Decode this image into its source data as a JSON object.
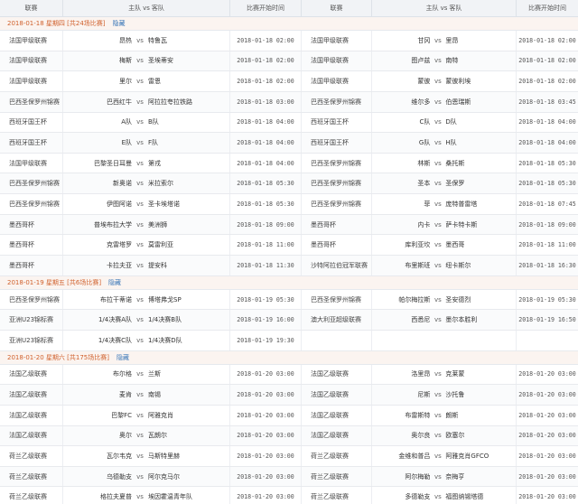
{
  "header": {
    "league": "联赛",
    "home": "主队",
    "vs": "vs",
    "away": "客队",
    "time": "比赛开始时间",
    "league2": "联赛",
    "time2": "比赛开始时间"
  },
  "days": [
    {
      "label": "2018-01-18 星期四 [共24场比赛]",
      "fold": "隐藏",
      "rows": [
        {
          "l1": "法国甲级联赛",
          "h1": "昂热",
          "a1": "特鲁瓦",
          "t1": "2018-01-18 02:00",
          "l2": "法国甲级联赛",
          "h2": "甘冈",
          "a2": "里昂",
          "t2": "2018-01-18 02:00"
        },
        {
          "l1": "法国甲级联赛",
          "h1": "梅斯",
          "a1": "圣埃蒂安",
          "t1": "2018-01-18 02:00",
          "l2": "法国甲级联赛",
          "h2": "图卢兹",
          "a2": "南特",
          "t2": "2018-01-18 02:00"
        },
        {
          "l1": "法国甲级联赛",
          "h1": "里尔",
          "a1": "雷恩",
          "t1": "2018-01-18 02:00",
          "l2": "法国甲级联赛",
          "h2": "蒙彼",
          "a2": "蒙彼利埃",
          "t2": "2018-01-18 02:00"
        },
        {
          "l1": "巴西圣保罗州锦赛",
          "h1": "巴西红牛",
          "a1": "阿拉拉夸拉铁路",
          "t1": "2018-01-18 03:00",
          "l2": "巴西圣保罗州锦赛",
          "h2": "维尔多",
          "a2": "伯恩瑞斯",
          "t2": "2018-01-18 03:45"
        },
        {
          "l1": "西班牙国王杯",
          "h1": "A队",
          "a1": "B队",
          "t1": "2018-01-18 04:00",
          "l2": "西班牙国王杯",
          "h2": "C队",
          "a2": "D队",
          "t2": "2018-01-18 04:00"
        },
        {
          "l1": "西班牙国王杯",
          "h1": "E队",
          "a1": "F队",
          "t1": "2018-01-18 04:00",
          "l2": "西班牙国王杯",
          "h2": "G队",
          "a2": "H队",
          "t2": "2018-01-18 04:00"
        },
        {
          "l1": "法国甲级联赛",
          "h1": "巴黎圣日耳曼",
          "a1": "第戎",
          "t1": "2018-01-18 04:00",
          "l2": "巴西圣保罗州锦赛",
          "h2": "林斯",
          "a2": "桑托斯",
          "t2": "2018-01-18 05:30"
        },
        {
          "l1": "巴西圣保罗州锦赛",
          "h1": "新奥诺",
          "a1": "米拉索尔",
          "t1": "2018-01-18 05:30",
          "l2": "巴西圣保罗州锦赛",
          "h2": "圣本",
          "a2": "圣保罗",
          "t2": "2018-01-18 05:30"
        },
        {
          "l1": "巴西圣保罗州锦赛",
          "h1": "伊图阿诺",
          "a1": "圣卡埃塔诺",
          "t1": "2018-01-18 05:30",
          "l2": "巴西圣保罗州锦赛",
          "h2": "菲",
          "a2": "庞特普雷塔",
          "t2": "2018-01-18 07:45"
        },
        {
          "l1": "墨西哥杯",
          "h1": "普埃布拉大学",
          "a1": "美洲狮",
          "t1": "2018-01-18 09:00",
          "l2": "墨西哥杯",
          "h2": "内卡",
          "a2": "萨卡特卡斯",
          "t2": "2018-01-18 09:00"
        },
        {
          "l1": "墨西哥杯",
          "h1": "克雷塔罗",
          "a1": "莫雷利亚",
          "t1": "2018-01-18 11:00",
          "l2": "墨西哥杯",
          "h2": "库利亚坎",
          "a2": "墨西哥",
          "t2": "2018-01-18 11:00"
        },
        {
          "l1": "墨西哥杯",
          "h1": "卡拉夫亚",
          "a1": "提安科",
          "t1": "2018-01-18 11:30",
          "l2": "沙特阿拉伯冠军联赛",
          "h2": "布里斯班",
          "a2": "纽卡斯尔",
          "t2": "2018-01-18 16:30"
        }
      ]
    },
    {
      "label": "2018-01-19 星期五 [共6场比赛]",
      "fold": "隐藏",
      "rows": [
        {
          "l1": "巴西圣保罗州锦赛",
          "h1": "布拉干蒂诺",
          "a1": "博塔弗戈SP",
          "t1": "2018-01-19 05:30",
          "l2": "巴西圣保罗州锦赛",
          "h2": "帕尔梅拉斯",
          "a2": "圣安德烈",
          "t2": "2018-01-19 05:30"
        },
        {
          "l1": "亚洲U23锦标赛",
          "h1": "1/4决赛A队",
          "a1": "1/4决赛B队",
          "t1": "2018-01-19 16:00",
          "l2": "澳大利亚超级联赛",
          "h2": "西悉尼",
          "a2": "墨尔本胜利",
          "t2": "2018-01-19 16:50"
        },
        {
          "l1": "亚洲U23锦标赛",
          "h1": "1/4决赛C队",
          "a1": "1/4决赛D队",
          "t1": "2018-01-19 19:30",
          "l2": "",
          "h2": "",
          "a2": "",
          "t2": ""
        }
      ]
    },
    {
      "label": "2018-01-20 星期六 [共175场比赛]",
      "fold": "隐藏",
      "rows": [
        {
          "l1": "法国乙级联赛",
          "h1": "布尔格",
          "a1": "兰斯",
          "t1": "2018-01-20 03:00",
          "l2": "法国乙级联赛",
          "h2": "洛里昂",
          "a2": "克莱蒙",
          "t2": "2018-01-20 03:00"
        },
        {
          "l1": "法国乙级联赛",
          "h1": "麦肯",
          "a1": "南锡",
          "t1": "2018-01-20 03:00",
          "l2": "法国乙级联赛",
          "h2": "尼斯",
          "a2": "沙托鲁",
          "t2": "2018-01-20 03:00"
        },
        {
          "l1": "法国乙级联赛",
          "h1": "巴黎FC",
          "a1": "阿雅克肖",
          "t1": "2018-01-20 03:00",
          "l2": "法国乙级联赛",
          "h2": "布雷斯特",
          "a2": "朗斯",
          "t2": "2018-01-20 03:00"
        },
        {
          "l1": "法国乙级联赛",
          "h1": "奥尔",
          "a1": "瓦朗尔",
          "t1": "2018-01-20 03:00",
          "l2": "法国乙级联赛",
          "h2": "奥尔良",
          "a2": "欧塞尔",
          "t2": "2018-01-20 03:00"
        },
        {
          "l1": "荷兰乙级联赛",
          "h1": "瓦尔韦克",
          "a1": "马斯特里赫",
          "t1": "2018-01-20 03:00",
          "l2": "荷兰乙级联赛",
          "h2": "金维和普吕",
          "a2": "阿雅克肖GFCO",
          "t2": "2018-01-20 03:00"
        },
        {
          "l1": "荷兰乙级联赛",
          "h1": "乌德勒支",
          "a1": "阿尔克马尔",
          "t1": "2018-01-20 03:00",
          "l2": "荷兰乙级联赛",
          "h2": "阿尔梅勒",
          "a2": "奈梅亨",
          "t2": "2018-01-20 03:00"
        },
        {
          "l1": "荷兰乙级联赛",
          "h1": "格拉夫夏普",
          "a1": "埃因霍温青年队",
          "t1": "2018-01-20 03:00",
          "l2": "荷兰乙级联赛",
          "h2": "多德勒支",
          "a2": "福图纳锡塔德",
          "t2": "2018-01-20 03:00"
        }
      ]
    }
  ]
}
